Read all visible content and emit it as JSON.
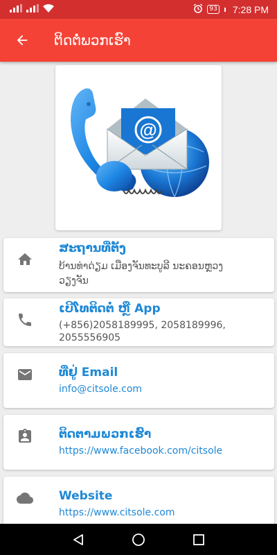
{
  "status_bar": {
    "battery": "93",
    "time": "7:28 PM"
  },
  "app_bar": {
    "title": "ຕິດຕໍ່ພວກເຮົາ",
    "back_icon": "arrow-back-icon"
  },
  "hero": {
    "icon": "contact-illustration",
    "email_symbol": "@"
  },
  "cards": {
    "location": {
      "icon": "home-icon",
      "title": "ສະຖານທີ່ຕັ້ງ",
      "line1": "ບ້ານທ່າດ່ຽມ ເມືອງຈັນທະບູລີ ນະຄອນຫຼວງ",
      "line2": "ວຽງຈັນ"
    },
    "phone": {
      "icon": "phone-icon",
      "title": "ເບີໂທຕິດຕໍ່ ຫຼື App",
      "line1": "(+856)2058189995, 2058189996,",
      "line2": "2055556905"
    },
    "email": {
      "icon": "mail-icon",
      "title": "ທີ່ຢູ່ Email",
      "value": "info@citsole.com"
    },
    "follow": {
      "icon": "contact-badge-icon",
      "title": "ຕິດຕາມພວກເຮົາ",
      "value": "https://www.facebook.com/citsole"
    },
    "website": {
      "icon": "cloud-icon",
      "title": "Website",
      "value": "https://www.citsole.com"
    }
  },
  "nav_bar": {
    "back_icon": "nav-back-icon",
    "home_icon": "nav-home-icon",
    "recents_icon": "nav-recents-icon"
  },
  "colors": {
    "status_bar": "#d32f2f",
    "app_bar": "#f44336",
    "accent": "#1e88d6",
    "icon": "#757575"
  }
}
